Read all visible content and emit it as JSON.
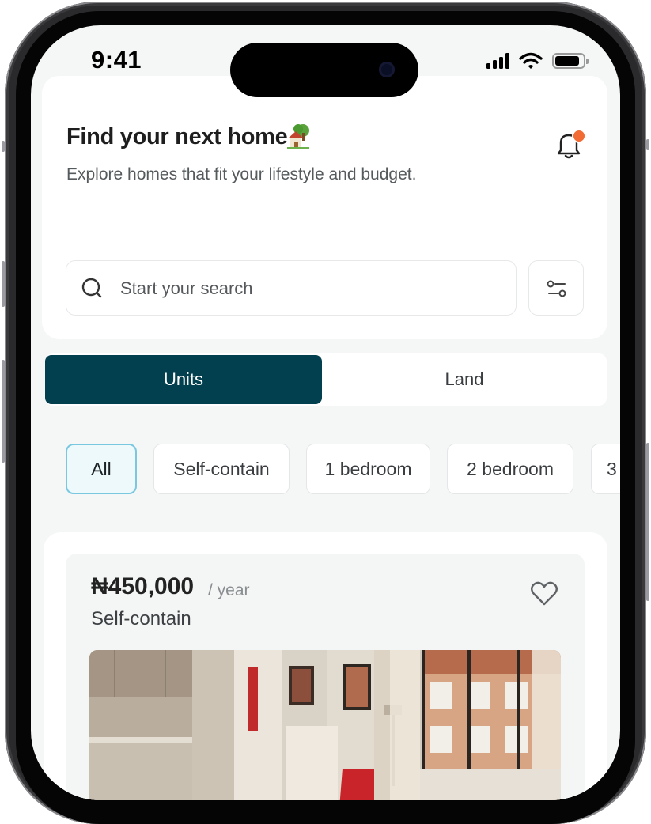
{
  "status_bar": {
    "time": "9:41"
  },
  "header": {
    "title": "Find your next home",
    "title_emoji_icon": "house-with-garden-icon",
    "subtitle": "Explore homes that fit your lifestyle and budget.",
    "notification_icon": "bell-icon",
    "notification_badge_color": "#f26a34"
  },
  "search": {
    "placeholder": "Start your search",
    "icon": "search-icon",
    "filter_icon": "sliders-icon"
  },
  "segment": {
    "tabs": [
      {
        "label": "Units",
        "active": true
      },
      {
        "label": "Land",
        "active": false
      }
    ],
    "active_color": "#03404f"
  },
  "filters": {
    "chips": [
      {
        "label": "All",
        "active": true
      },
      {
        "label": "Self-contain",
        "active": false
      },
      {
        "label": "1 bedroom",
        "active": false
      },
      {
        "label": "2 bedroom",
        "active": false
      },
      {
        "label": "3",
        "active": false
      }
    ]
  },
  "listing": {
    "price": "₦450,000",
    "period": "/ year",
    "type": "Self-contain",
    "favorite_icon": "heart-outline-icon",
    "image_icon": "apartment-photo"
  }
}
